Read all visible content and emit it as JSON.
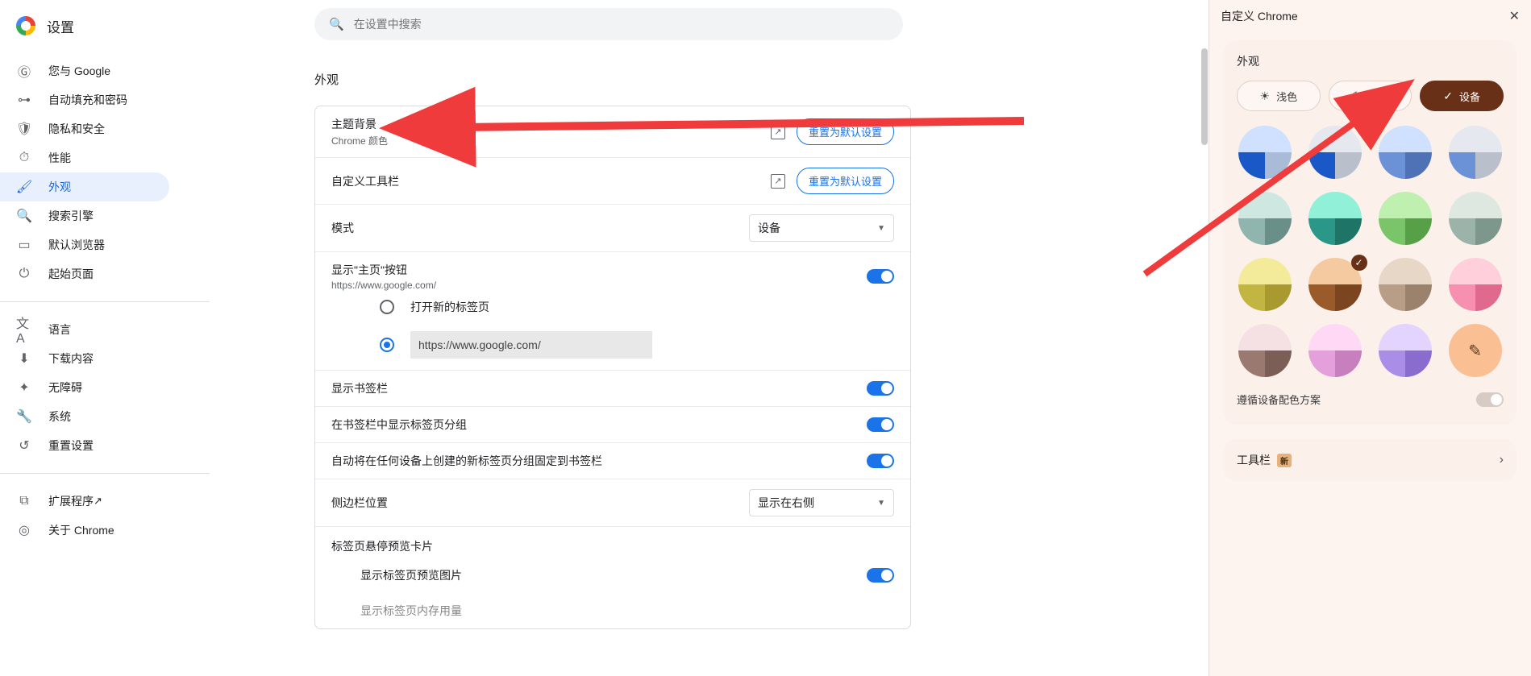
{
  "app": {
    "title": "设置",
    "search_placeholder": "在设置中搜索"
  },
  "sidebar": {
    "items": [
      {
        "label": "您与 Google",
        "icon": "Ⓖ"
      },
      {
        "label": "自动填充和密码",
        "icon": "⊶"
      },
      {
        "label": "隐私和安全",
        "icon": "🛡"
      },
      {
        "label": "性能",
        "icon": "⏱"
      },
      {
        "label": "外观",
        "icon": "🖌",
        "active": true
      },
      {
        "label": "搜索引擎",
        "icon": "🔍"
      },
      {
        "label": "默认浏览器",
        "icon": "▭"
      },
      {
        "label": "起始页面",
        "icon": "⏻"
      }
    ],
    "items2": [
      {
        "label": "语言",
        "icon": "文A"
      },
      {
        "label": "下载内容",
        "icon": "⬇"
      },
      {
        "label": "无障碍",
        "icon": "✦"
      },
      {
        "label": "系统",
        "icon": "🔧"
      },
      {
        "label": "重置设置",
        "icon": "↺"
      }
    ],
    "items3": [
      {
        "label": "扩展程序",
        "icon": "⧉",
        "external": true
      },
      {
        "label": "关于 Chrome",
        "icon": "◎"
      }
    ]
  },
  "main": {
    "section_title": "外观",
    "theme_title": "主题背景",
    "theme_sub": "Chrome 颜色",
    "reset1": "重置为默认设置",
    "toolbar_title": "自定义工具栏",
    "reset2": "重置为默认设置",
    "mode_label": "模式",
    "mode_value": "设备",
    "home_label": "显示\"主页\"按钮",
    "home_sub": "https://www.google.com/",
    "radio_newtab": "打开新的标签页",
    "radio_url": "https://www.google.com/",
    "bookmarks_label": "显示书签栏",
    "tabgroup_label": "在书签栏中显示标签页分组",
    "pin_label": "自动将在任何设备上创建的新标签页分组固定到书签栏",
    "sidebar_pos_label": "侧边栏位置",
    "sidebar_pos_value": "显示在右侧",
    "hover_title": "标签页悬停预览卡片",
    "hover_img": "显示标签页预览图片",
    "hover_mem": "显示标签页内存用量"
  },
  "panel": {
    "title": "自定义 Chrome",
    "appearance_title": "外观",
    "mode_light": "浅色",
    "mode_dark": "深色",
    "mode_device": "设备",
    "follow_label": "遵循设备配色方案",
    "toolbar_label": "工具栏",
    "toolbar_badge": "新",
    "swatches": [
      {
        "top": "#cfe1ff",
        "bl": "#1a57c7",
        "br": "#a9bbd7",
        "checked": false
      },
      {
        "top": "#e5e8ee",
        "bl": "#1a57c7",
        "br": "#b9c0cc",
        "checked": false
      },
      {
        "top": "#cfe1ff",
        "bl": "#6b92d6",
        "br": "#4e72b5",
        "checked": false
      },
      {
        "top": "#e5e8ee",
        "bl": "#6b92d6",
        "br": "#b9c0cc",
        "checked": false
      },
      {
        "top": "#cfe7e1",
        "bl": "#8fb5ae",
        "br": "#6a8f88",
        "checked": false
      },
      {
        "top": "#90f0d8",
        "bl": "#2a9788",
        "br": "#1e7467",
        "checked": false
      },
      {
        "top": "#c0f0b0",
        "bl": "#7ac46a",
        "br": "#58a048",
        "checked": false
      },
      {
        "top": "#dfe7e1",
        "bl": "#9bb3a8",
        "br": "#7d978c",
        "checked": false
      },
      {
        "top": "#f3ea9a",
        "bl": "#c3b542",
        "br": "#a89a2e",
        "checked": false
      },
      {
        "top": "#f5caa0",
        "bl": "#9a5a2a",
        "br": "#7a451f",
        "checked": true
      },
      {
        "top": "#e7d7c7",
        "bl": "#b89e86",
        "br": "#9a826c",
        "checked": false
      },
      {
        "top": "#ffd0dc",
        "bl": "#f78fb0",
        "br": "#e06a8e",
        "checked": false
      },
      {
        "top": "#f5e1e4",
        "bl": "#9a7a70",
        "br": "#7b5e55",
        "checked": false
      },
      {
        "top": "#ffd8f5",
        "bl": "#e4a0da",
        "br": "#c77fbd",
        "checked": false
      },
      {
        "top": "#e3d3ff",
        "bl": "#a98de6",
        "br": "#8a6ccf",
        "checked": false
      }
    ]
  }
}
